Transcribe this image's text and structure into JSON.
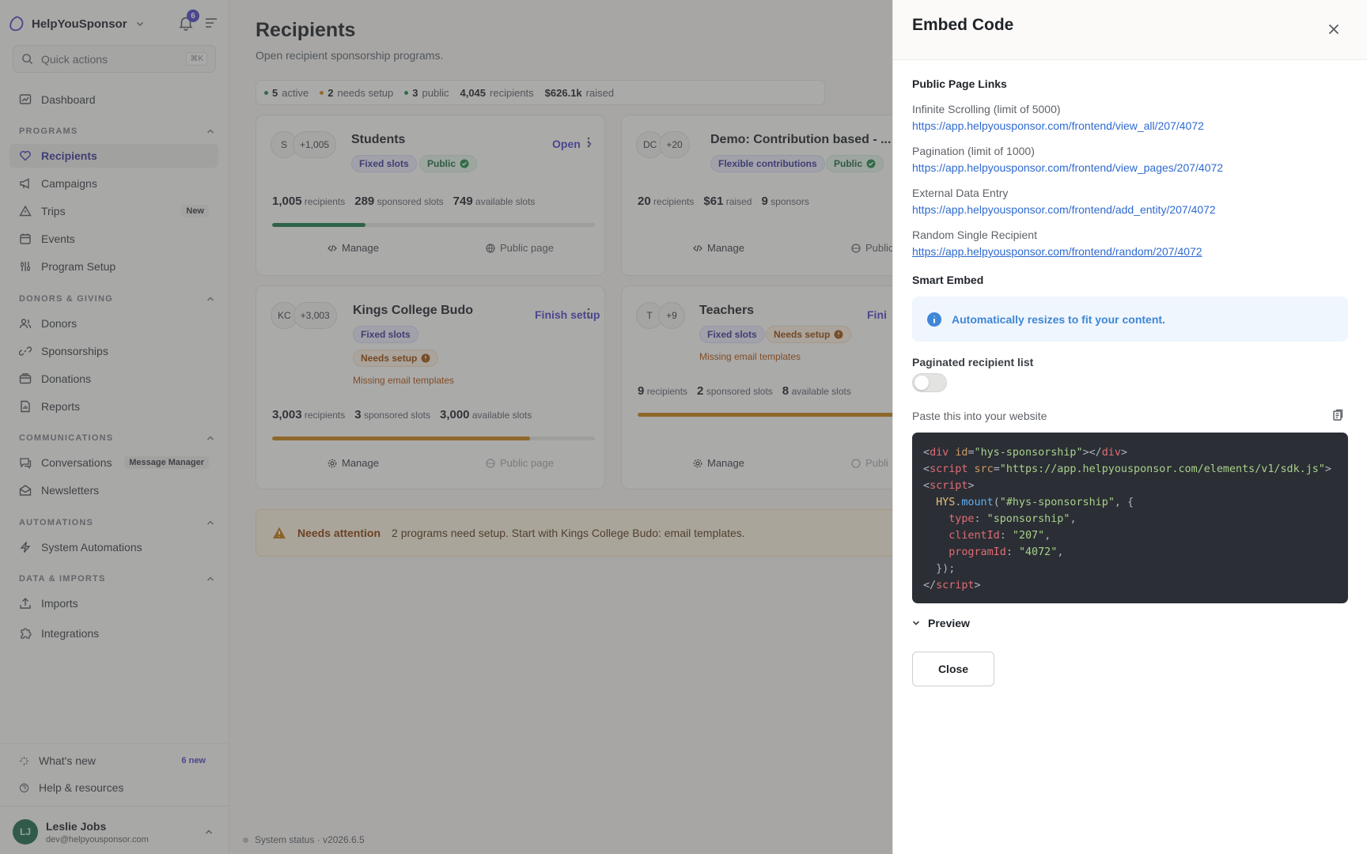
{
  "brand": {
    "name": "HelpYouSponsor",
    "notifications": "6"
  },
  "search": {
    "placeholder": "Quick actions",
    "shortcut": "⌘K"
  },
  "nav": {
    "dashboard": "Dashboard",
    "programs_section": "PROGRAMS",
    "recipients": "Recipients",
    "campaigns": "Campaigns",
    "trips": "Trips",
    "trips_tag": "New",
    "events": "Events",
    "program_setup": "Program Setup",
    "donors_section": "DONORS & GIVING",
    "donors": "Donors",
    "sponsorships": "Sponsorships",
    "donations": "Donations",
    "reports": "Reports",
    "comms_section": "COMMUNICATIONS",
    "conversations": "Conversations",
    "conversations_tag": "Message Manager",
    "newsletters": "Newsletters",
    "automations_section": "AUTOMATIONS",
    "system_automations": "System Automations",
    "data_section": "DATA & IMPORTS",
    "imports": "Imports",
    "integrations": "Integrations"
  },
  "footer": {
    "whats_new": "What's new",
    "whats_new_count": "6 new",
    "help": "Help & resources",
    "user_initials": "LJ",
    "user_name": "Leslie Jobs",
    "user_email": "dev@helpyousponsor.com"
  },
  "page": {
    "title": "Recipients",
    "subtitle": "Open recipient sponsorship programs.",
    "stats": [
      {
        "value": "5",
        "label": "active",
        "color": "#1f8a4c"
      },
      {
        "value": "2",
        "label": "needs setup",
        "color": "#d08a18"
      },
      {
        "value": "3",
        "label": "public",
        "color": "#1f8a4c"
      },
      {
        "value": "4,045",
        "label": "recipients"
      },
      {
        "value": "$626.1k",
        "label": "raised"
      }
    ]
  },
  "cards": [
    {
      "avatar": "S",
      "more": "+1,005",
      "name": "Students",
      "action": "Open",
      "tags": [
        "Fixed slots",
        "Public"
      ],
      "metrics": [
        [
          "1,005",
          "recipients"
        ],
        [
          "289",
          "sponsored slots"
        ],
        [
          "749",
          "available slots"
        ]
      ],
      "progress": 0.288,
      "progress_color": "#1d7a47",
      "links": [
        "Manage",
        "Public page"
      ]
    },
    {
      "avatar": "DC",
      "more": "+20",
      "name": "Demo: Contribution based - ...",
      "tags": [
        "Flexible contributions",
        "Public"
      ],
      "metrics": [
        [
          "20",
          "recipients"
        ],
        [
          "$61",
          "raised"
        ],
        [
          "9",
          "sponsors"
        ]
      ],
      "links": [
        "Manage",
        "Public"
      ]
    },
    {
      "avatar": "KC",
      "more": "+3,003",
      "name": "Kings College Budo",
      "action": "Finish setup",
      "tags": [
        "Fixed slots",
        "Needs setup"
      ],
      "warning": "Missing email templates",
      "metrics": [
        [
          "3,003",
          "recipients"
        ],
        [
          "3",
          "sponsored slots"
        ],
        [
          "3,000",
          "available slots"
        ]
      ],
      "progress": 0.8,
      "progress_color": "#c98414",
      "links": [
        "Manage",
        "Public page"
      ]
    },
    {
      "avatar": "T",
      "more": "+9",
      "name": "Teachers",
      "action": "Fini",
      "tags": [
        "Fixed slots",
        "Needs setup"
      ],
      "warning": "Missing email templates",
      "metrics": [
        [
          "9",
          "recipients"
        ],
        [
          "2",
          "sponsored slots"
        ],
        [
          "8",
          "available slots"
        ]
      ],
      "progress": 0.8,
      "progress_color": "#c98414",
      "links": [
        "Manage",
        "Publi"
      ]
    }
  ],
  "attention": {
    "title": "Needs attention",
    "text": "2 programs need setup. Start with Kings College Budo: email templates."
  },
  "status": "System status · v2026.6.5",
  "embed": {
    "title": "Embed Code",
    "public_links_heading": "Public Page Links",
    "links": [
      {
        "label": "Infinite Scrolling (limit of 5000)",
        "url": "https://app.helpyousponsor.com/frontend/view_all/207/4072"
      },
      {
        "label": "Pagination (limit of 1000)",
        "url": "https://app.helpyousponsor.com/frontend/view_pages/207/4072"
      },
      {
        "label": "External Data Entry",
        "url": "https://app.helpyousponsor.com/frontend/add_entity/207/4072"
      },
      {
        "label": "Random Single Recipient",
        "url": "https://app.helpyousponsor.com/frontend/random/207/4072"
      }
    ],
    "smart_heading": "Smart Embed",
    "info": "Automatically resizes to fit your content.",
    "toggle_label": "Paginated recipient list",
    "toggle_on": false,
    "paste_label": "Paste this into your website",
    "code": {
      "div_id": "hys-sponsorship",
      "script_src": "https://app.helpyousponsor.com/elements/v1/sdk.js",
      "mount_target": "#hys-sponsorship",
      "type": "sponsorship",
      "client_id": "207",
      "program_id": "4072"
    },
    "preview_label": "Preview",
    "close_label": "Close"
  }
}
